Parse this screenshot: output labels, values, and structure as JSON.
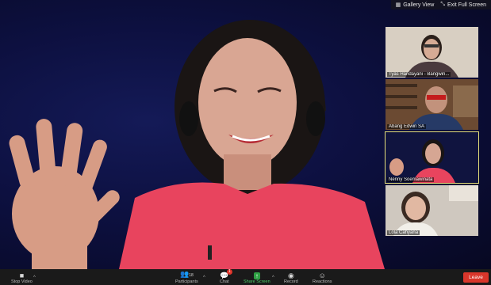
{
  "top_controls": {
    "gallery_view_label": "Gallery View",
    "exit_full_screen_label": "Exit Full Screen"
  },
  "participants": [
    {
      "name": "Tyas Handayani - Bangwin..."
    },
    {
      "name": "Abang Edwin SA"
    },
    {
      "name": "Nenny Soemawinata"
    },
    {
      "name": "Lola Cahyana"
    }
  ],
  "toolbar": {
    "stop_video_label": "Stop Video",
    "participants_label": "Participants",
    "participants_count": "18",
    "chat_label": "Chat",
    "chat_badge": "1",
    "share_screen_label": "Share Screen",
    "record_label": "Record",
    "reactions_label": "Reactions",
    "leave_label": "Leave"
  },
  "colors": {
    "active_speaker_border": "#e6e07a",
    "leave_button": "#d9362b",
    "share_screen": "#2ea043"
  }
}
